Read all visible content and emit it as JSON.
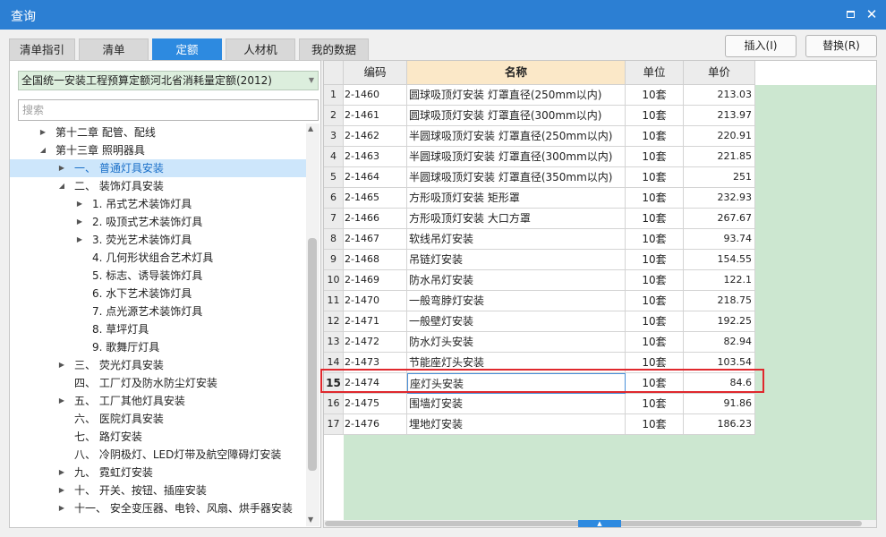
{
  "window": {
    "title": "查询"
  },
  "tabs": [
    {
      "label": "清单指引",
      "active": false
    },
    {
      "label": "清单",
      "active": false
    },
    {
      "label": "定额",
      "active": true
    },
    {
      "label": "人材机",
      "active": false
    },
    {
      "label": "我的数据",
      "active": false
    }
  ],
  "buttons": {
    "insert": "插入(I)",
    "replace": "替换(R)"
  },
  "library": {
    "selected": "全国统一安装工程预算定额河北省消耗量定额(2012)"
  },
  "search": {
    "placeholder": "搜索"
  },
  "tree": [
    {
      "label": "第十二章 配管、配线",
      "level": 0,
      "toggle": "collapsed",
      "selected": false
    },
    {
      "label": "第十三章 照明器具",
      "level": 0,
      "toggle": "expanded",
      "selected": false
    },
    {
      "label": "一、 普通灯具安装",
      "level": 1,
      "toggle": "collapsed",
      "selected": true
    },
    {
      "label": "二、 装饰灯具安装",
      "level": 1,
      "toggle": "expanded",
      "selected": false
    },
    {
      "label": "1. 吊式艺术装饰灯具",
      "level": 2,
      "toggle": "collapsed",
      "selected": false
    },
    {
      "label": "2. 吸顶式艺术装饰灯具",
      "level": 2,
      "toggle": "collapsed",
      "selected": false
    },
    {
      "label": "3. 荧光艺术装饰灯具",
      "level": 2,
      "toggle": "collapsed",
      "selected": false
    },
    {
      "label": "4. 几何形状组合艺术灯具",
      "level": 2,
      "toggle": "none",
      "selected": false
    },
    {
      "label": "5. 标志、诱导装饰灯具",
      "level": 2,
      "toggle": "none",
      "selected": false
    },
    {
      "label": "6. 水下艺术装饰灯具",
      "level": 2,
      "toggle": "none",
      "selected": false
    },
    {
      "label": "7. 点光源艺术装饰灯具",
      "level": 2,
      "toggle": "none",
      "selected": false
    },
    {
      "label": "8. 草坪灯具",
      "level": 2,
      "toggle": "none",
      "selected": false
    },
    {
      "label": "9. 歌舞厅灯具",
      "level": 2,
      "toggle": "none",
      "selected": false
    },
    {
      "label": "三、 荧光灯具安装",
      "level": 1,
      "toggle": "collapsed",
      "selected": false
    },
    {
      "label": "四、 工厂灯及防水防尘灯安装",
      "level": 1,
      "toggle": "none",
      "selected": false
    },
    {
      "label": "五、 工厂其他灯具安装",
      "level": 1,
      "toggle": "collapsed",
      "selected": false
    },
    {
      "label": "六、 医院灯具安装",
      "level": 1,
      "toggle": "none",
      "selected": false
    },
    {
      "label": "七、 路灯安装",
      "level": 1,
      "toggle": "none",
      "selected": false
    },
    {
      "label": "八、 冷阴极灯、LED灯带及航空障碍灯安装",
      "level": 1,
      "toggle": "none",
      "selected": false
    },
    {
      "label": "九、 霓虹灯安装",
      "level": 1,
      "toggle": "collapsed",
      "selected": false
    },
    {
      "label": "十、 开关、按钮、插座安装",
      "level": 1,
      "toggle": "collapsed",
      "selected": false
    },
    {
      "label": "十一、 安全变压器、电铃、风扇、烘手器安装",
      "level": 1,
      "toggle": "collapsed",
      "selected": false
    }
  ],
  "table": {
    "columns": {
      "code": "编码",
      "name": "名称",
      "unit": "单位",
      "price": "单价"
    },
    "current_row": 15,
    "rows": [
      {
        "no": "1",
        "code": "2-1460",
        "name": "圆球吸顶灯安装 灯罩直径(250mm以内)",
        "unit": "10套",
        "price": "213.03"
      },
      {
        "no": "2",
        "code": "2-1461",
        "name": "圆球吸顶灯安装 灯罩直径(300mm以内)",
        "unit": "10套",
        "price": "213.97"
      },
      {
        "no": "3",
        "code": "2-1462",
        "name": "半圆球吸顶灯安装 灯罩直径(250mm以内)",
        "unit": "10套",
        "price": "220.91"
      },
      {
        "no": "4",
        "code": "2-1463",
        "name": "半圆球吸顶灯安装 灯罩直径(300mm以内)",
        "unit": "10套",
        "price": "221.85"
      },
      {
        "no": "5",
        "code": "2-1464",
        "name": "半圆球吸顶灯安装 灯罩直径(350mm以内)",
        "unit": "10套",
        "price": "251"
      },
      {
        "no": "6",
        "code": "2-1465",
        "name": "方形吸顶灯安装 矩形罩",
        "unit": "10套",
        "price": "232.93"
      },
      {
        "no": "7",
        "code": "2-1466",
        "name": "方形吸顶灯安装 大口方罩",
        "unit": "10套",
        "price": "267.67"
      },
      {
        "no": "8",
        "code": "2-1467",
        "name": "软线吊灯安装",
        "unit": "10套",
        "price": "93.74"
      },
      {
        "no": "9",
        "code": "2-1468",
        "name": "吊链灯安装",
        "unit": "10套",
        "price": "154.55"
      },
      {
        "no": "10",
        "code": "2-1469",
        "name": "防水吊灯安装",
        "unit": "10套",
        "price": "122.1"
      },
      {
        "no": "11",
        "code": "2-1470",
        "name": "一般弯脖灯安装",
        "unit": "10套",
        "price": "218.75"
      },
      {
        "no": "12",
        "code": "2-1471",
        "name": "一般壁灯安装",
        "unit": "10套",
        "price": "192.25"
      },
      {
        "no": "13",
        "code": "2-1472",
        "name": "防水灯头安装",
        "unit": "10套",
        "price": "82.94"
      },
      {
        "no": "14",
        "code": "2-1473",
        "name": "节能座灯头安装",
        "unit": "10套",
        "price": "103.54"
      },
      {
        "no": "15",
        "code": "2-1474",
        "name": "座灯头安装",
        "unit": "10套",
        "price": "84.6"
      },
      {
        "no": "16",
        "code": "2-1475",
        "name": "围墙灯安装",
        "unit": "10套",
        "price": "91.86"
      },
      {
        "no": "17",
        "code": "2-1476",
        "name": "埋地灯安装",
        "unit": "10套",
        "price": "186.23"
      }
    ]
  },
  "colors": {
    "titlebar": "#2c7fd3",
    "active_tab": "#2d8ae0",
    "highlight_box": "#e0282d",
    "grid_empty": "#cce7d0",
    "library_combo": "#dceedd"
  }
}
